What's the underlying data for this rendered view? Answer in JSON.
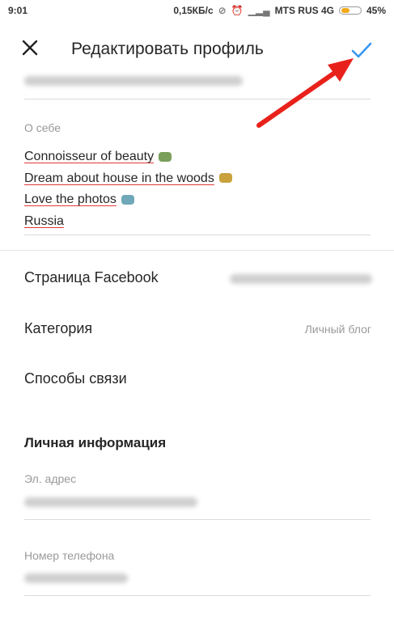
{
  "statusbar": {
    "time": "9:01",
    "network_speed": "0,15КБ/с",
    "carrier": "MTS RUS 4G",
    "battery_percent": "45%",
    "battery_level": 0.45
  },
  "header": {
    "title": "Редактировать профиль",
    "close_icon": "close-icon",
    "confirm_icon": "check-icon",
    "confirm_color": "#3897f0"
  },
  "bio": {
    "label": "О себе",
    "lines": [
      "Connoisseur of beauty",
      "Dream about house in the woods",
      "Love the photos",
      "Russia"
    ]
  },
  "rows": {
    "facebook_label": "Страница Facebook",
    "category_label": "Категория",
    "category_value": "Личный блог",
    "contacts_label": "Способы связи"
  },
  "personal": {
    "title": "Личная информация",
    "email_label": "Эл. адрес",
    "phone_label": "Номер телефона"
  },
  "annotation": {
    "arrow_color": "#e8221b"
  }
}
